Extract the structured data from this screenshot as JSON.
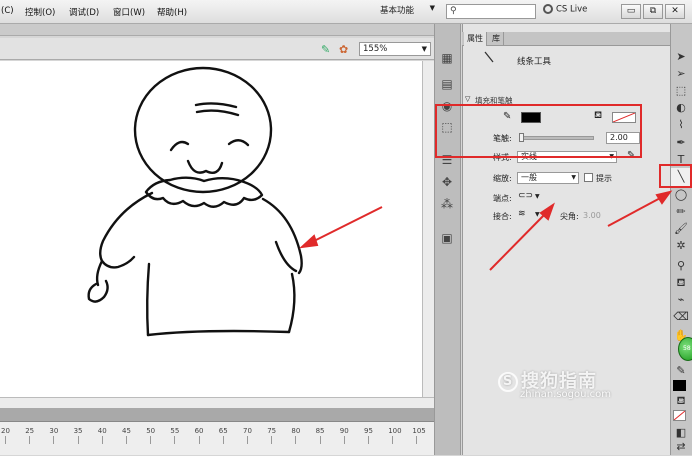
{
  "menu": {
    "items": [
      "(C)",
      "控制(O)",
      "调试(D)",
      "窗口(W)",
      "帮助(H)"
    ],
    "workspace": "基本功能",
    "search_placeholder": "",
    "cslive": "CS Live"
  },
  "stage": {
    "zoom": "155%"
  },
  "timeline": {
    "ticks": [
      "20",
      "25",
      "30",
      "35",
      "40",
      "45",
      "50",
      "55",
      "60",
      "65",
      "70",
      "75",
      "80",
      "85",
      "90",
      "95",
      "100",
      "105"
    ]
  },
  "properties": {
    "tabs": [
      "属性",
      "库"
    ],
    "tool_name": "线条工具",
    "section_fill_stroke": "填充和笔触",
    "stroke_label": "笔触:",
    "stroke_value": "2.00",
    "style_label": "样式:",
    "style_value": "实线",
    "scale_label": "缩放:",
    "scale_value": "一般",
    "hint_label": "提示",
    "cap_label": "端点:",
    "join_label": "接合:",
    "miter_label": "尖角:",
    "miter_value": "3.00"
  },
  "watermark": {
    "brand": "搜狗指南",
    "url": "zhinan.sogou.com"
  },
  "colors": {
    "annotation_red": "#e02a2a",
    "stroke_color": "#000000"
  }
}
